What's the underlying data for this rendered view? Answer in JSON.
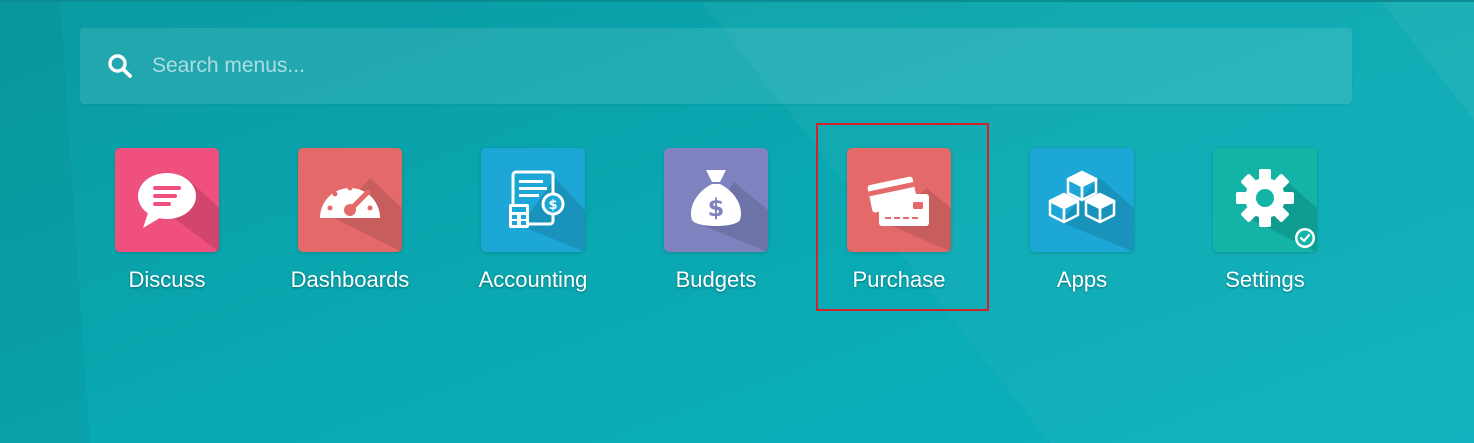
{
  "search": {
    "placeholder": "Search menus...",
    "icon": "search-icon"
  },
  "apps": [
    {
      "label": "Discuss",
      "icon": "chat-bubble-icon",
      "color": "#f0507e"
    },
    {
      "label": "Dashboards",
      "icon": "speedometer-icon",
      "color": "#e46a6a"
    },
    {
      "label": "Accounting",
      "icon": "invoice-calculator-icon",
      "color": "#1da7d7"
    },
    {
      "label": "Budgets",
      "icon": "money-bag-icon",
      "color": "#7e83bf"
    },
    {
      "label": "Purchase",
      "icon": "credit-cards-icon",
      "color": "#e46a6a"
    },
    {
      "label": "Apps",
      "icon": "cubes-icon",
      "color": "#1da7d7"
    },
    {
      "label": "Settings",
      "icon": "gear-icon",
      "color": "#13b3a5"
    }
  ],
  "colors": {
    "background": "#0aa7b0",
    "highlight": "#d2232a"
  }
}
